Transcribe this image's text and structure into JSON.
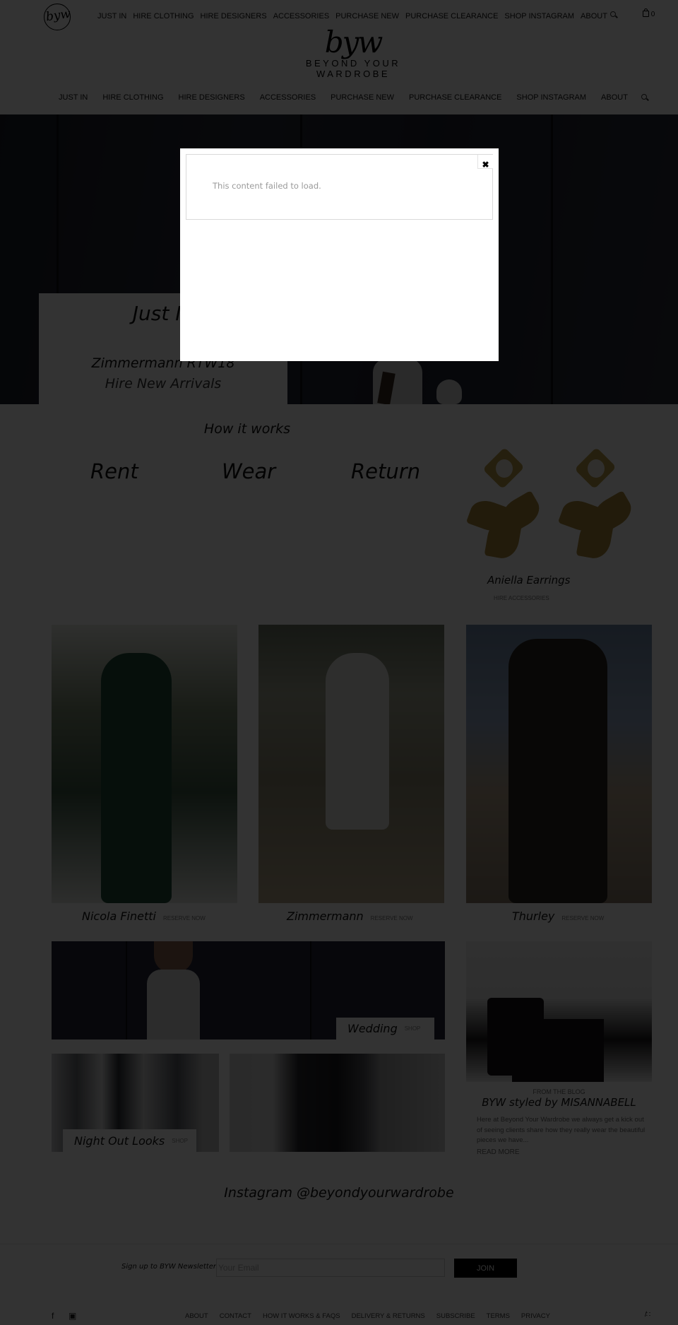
{
  "header": {
    "brand_script": "byw",
    "brand_wordmark": "BEYOND YOUR WARDROBE",
    "top_nav": [
      "JUST IN",
      "HIRE CLOTHING",
      "HIRE DESIGNERS",
      "ACCESSORIES",
      "PURCHASE NEW",
      "PURCHASE CLEARANCE",
      "SHOP INSTAGRAM",
      "ABOUT"
    ],
    "main_nav": [
      "JUST IN",
      "HIRE CLOTHING",
      "HIRE DESIGNERS",
      "ACCESSORIES",
      "PURCHASE NEW",
      "PURCHASE CLEARANCE",
      "SHOP INSTAGRAM",
      "ABOUT"
    ],
    "cart_count": "0",
    "icons": {
      "search": "search-icon",
      "cart": "shopping-bag-icon",
      "facebook": "facebook-icon",
      "instagram": "instagram-icon"
    }
  },
  "hero": {
    "title": "Just In",
    "subtitle": "Zimmermann RTW18",
    "tagline": "Hire New Arrivals"
  },
  "how_it_works": {
    "title": "How it works",
    "steps": [
      "Rent",
      "Wear",
      "Return"
    ]
  },
  "featured_accessory": {
    "name": "Aniella Earrings",
    "link": "HIRE ACCESSORIES"
  },
  "designers": [
    {
      "name": "Nicola Finetti",
      "action": "RESERVE NOW"
    },
    {
      "name": "Zimmermann",
      "action": "RESERVE NOW"
    },
    {
      "name": "Thurley",
      "action": "RESERVE NOW"
    }
  ],
  "collections": [
    {
      "name": "Wedding",
      "action": "SHOP"
    },
    {
      "name": "Night Out Looks",
      "action": "SHOP"
    }
  ],
  "blog": {
    "kicker": "FROM THE BLOG",
    "title": "BYW styled by MISANNABELL",
    "excerpt": "Here at Beyond Your Wardrobe we always get a kick out of seeing clients share how they really wear the beautiful pieces we have...",
    "read_more": "READ MORE"
  },
  "instagram": {
    "title": "Instagram @beyondyourwardrobe"
  },
  "newsletter": {
    "label": "Sign up to BYW Newsletter",
    "placeholder": "Your Email",
    "value": "",
    "button": "JOIN"
  },
  "footer": {
    "links": [
      "ABOUT",
      "CONTACT",
      "HOW IT WORKS & FAQS",
      "DELIVERY & RETURNS",
      "SUBSCRIBE",
      "TERMS",
      "PRIVACY"
    ],
    "social": {
      "facebook": "f",
      "instagram": "▣"
    },
    "credit": "/∷"
  },
  "modal": {
    "message": "This content failed to load.",
    "close_label": "✖"
  },
  "colors": {
    "overlay": "#000000",
    "accent_button": "#000000",
    "modal_text": "#9a9a9a"
  }
}
